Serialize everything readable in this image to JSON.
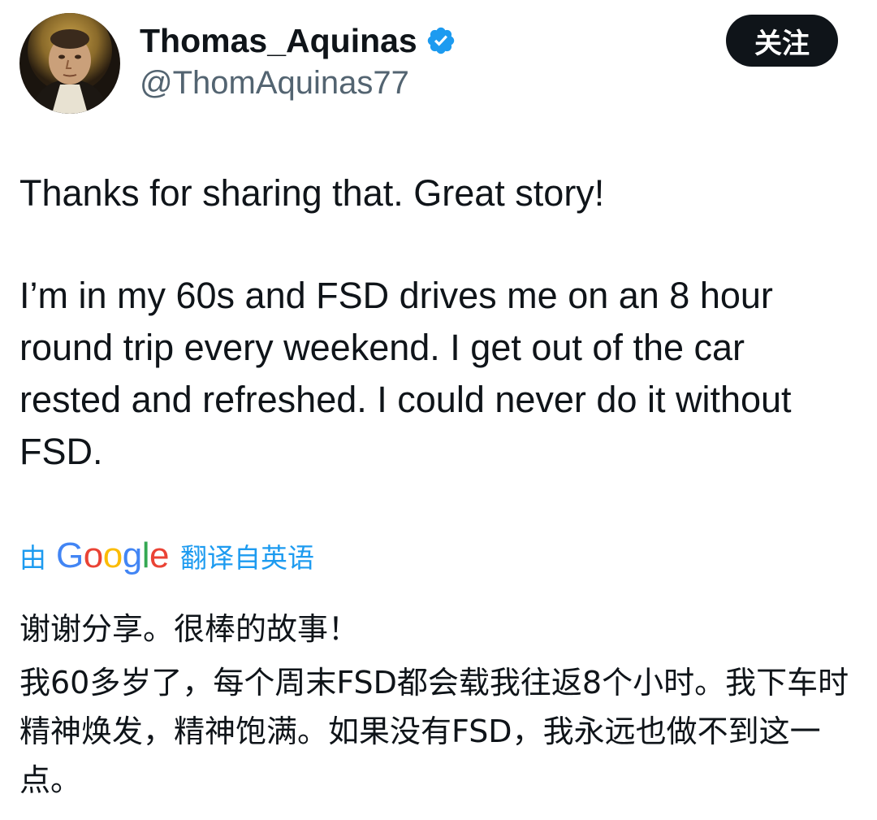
{
  "author": {
    "display_name": "Thomas_Aquinas",
    "handle": "@ThomAquinas77",
    "avatar_icon": "portrait-avatar",
    "verified_icon": "verified-badge-icon",
    "verified_color": "#1d9bf0"
  },
  "follow_button": {
    "label": "关注",
    "background": "#0f1419",
    "text_color": "#ffffff"
  },
  "tweet": {
    "paragraphs": [
      "Thanks for sharing that. Great story!",
      "I’m in my 60s and FSD drives me on an 8 hour round trip every weekend. I get out of the car rested and refreshed. I could never do it without FSD."
    ]
  },
  "translation": {
    "prefix": "由",
    "logo_letters": [
      "G",
      "o",
      "o",
      "g",
      "l",
      "e"
    ],
    "suffix": "翻译自英语",
    "link_color": "#1d9bf0",
    "paragraphs": [
      "谢谢分享。很棒的故事！",
      "我60多岁了，每个周末FSD都会载我往返8个小时。我下车时精神焕发，精神饱满。如果没有FSD，我永远也做不到这一点。"
    ]
  }
}
